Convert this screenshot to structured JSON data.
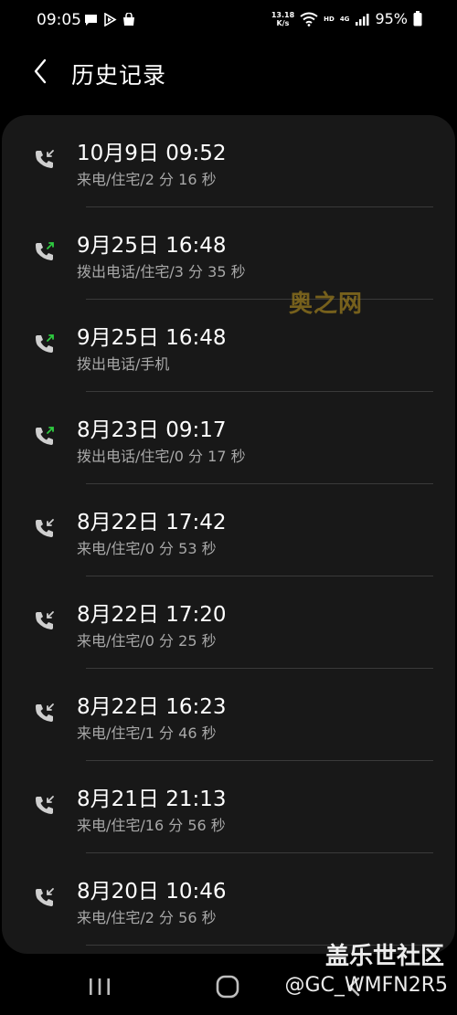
{
  "status_bar": {
    "time": "09:05",
    "net_speed_value": "13.18",
    "net_speed_unit": "K/s",
    "hd_label": "HD",
    "network_label": "4G",
    "battery": "95%"
  },
  "header": {
    "title": "历史记录"
  },
  "call_history": [
    {
      "datetime": "10月9日 09:52",
      "detail": "来电/住宅/2 分 16 秒",
      "type": "incoming"
    },
    {
      "datetime": "9月25日 16:48",
      "detail": "拨出电话/住宅/3 分 35 秒",
      "type": "outgoing"
    },
    {
      "datetime": "9月25日 16:48",
      "detail": "拨出电话/手机",
      "type": "outgoing"
    },
    {
      "datetime": "8月23日 09:17",
      "detail": "拨出电话/住宅/0 分 17 秒",
      "type": "outgoing"
    },
    {
      "datetime": "8月22日 17:42",
      "detail": "来电/住宅/0 分 53 秒",
      "type": "incoming"
    },
    {
      "datetime": "8月22日 17:20",
      "detail": "来电/住宅/0 分 25 秒",
      "type": "incoming"
    },
    {
      "datetime": "8月22日 16:23",
      "detail": "来电/住宅/1 分 46 秒",
      "type": "incoming"
    },
    {
      "datetime": "8月21日 21:13",
      "detail": "来电/住宅/16 分 56 秒",
      "type": "incoming"
    },
    {
      "datetime": "8月20日 10:46",
      "detail": "来电/住宅/2 分 56 秒",
      "type": "incoming"
    }
  ],
  "watermarks": {
    "center": "奥之网",
    "bottom": "盖乐世社区",
    "user": "@GC_WMFN2R5"
  },
  "colors": {
    "incoming_icon": "#cfcfcf",
    "outgoing_arrow": "#2ecc40",
    "card_bg": "#181818"
  }
}
